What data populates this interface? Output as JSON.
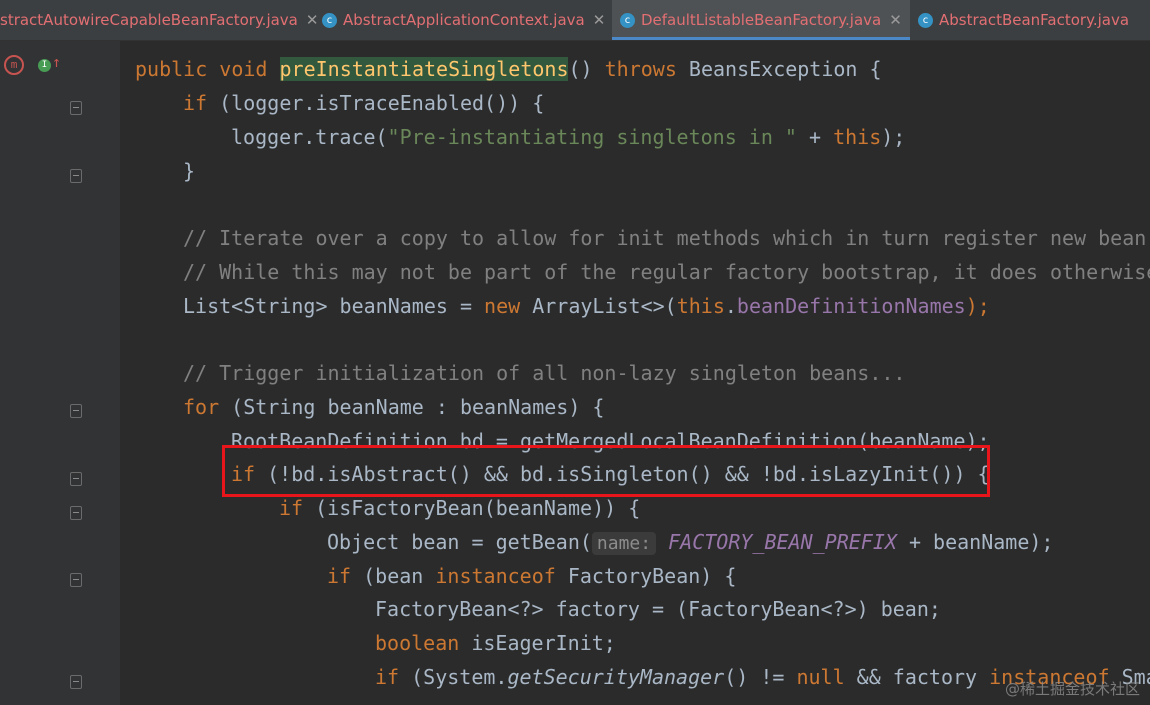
{
  "tabs": [
    {
      "label": "stractAutowireCapableBeanFactory.java"
    },
    {
      "label": "AbstractApplicationContext.java"
    },
    {
      "label": "DefaultListableBeanFactory.java"
    },
    {
      "label": "AbstractBeanFactory.java"
    }
  ],
  "code": {
    "l1": {
      "a": "public void ",
      "b": "preInstantiateSingletons",
      "c": "() ",
      "d": "throws",
      "e": " BeansException {"
    },
    "l2": {
      "a": "if",
      "b": " (logger.isTraceEnabled()) {"
    },
    "l3": {
      "a": "logger.trace(",
      "b": "\"Pre-instantiating singletons in \"",
      "c": " + ",
      "d": "this",
      "e": ");"
    },
    "l4": {
      "a": "}"
    },
    "l5": {
      "a": "// Iterate over a copy to allow for init methods which in turn register new bean"
    },
    "l6": {
      "a": "// While this may not be part of the regular factory bootstrap, it does otherwise"
    },
    "l7": {
      "a": "List<String> beanNames = ",
      "b": "new",
      "c": " ArrayList<>(",
      "d": "this",
      "e": ".",
      "f": "beanDefinitionNames",
      "g": ");"
    },
    "l8": {
      "a": "// Trigger initialization of all non-lazy singleton beans..."
    },
    "l9": {
      "a": "for",
      "b": " (String beanName : beanNames) {"
    },
    "l10": {
      "a": "RootBeanDefinition bd = getMergedLocalBeanDefinition(beanName);"
    },
    "l11": {
      "a": "if",
      "b": " (!bd.isAbstract() && bd.isSingleton() && !bd.isLazyInit()) {"
    },
    "l12": {
      "a": "if",
      "b": " (isFactoryBean(beanName)) {"
    },
    "l13": {
      "a": "Object bean = getBean(",
      "hint": "name:",
      "c": "FACTORY_BEAN_PREFIX",
      "d": " + beanName);"
    },
    "l14": {
      "a": "if",
      "b": " (bean ",
      "c": "instanceof",
      "d": " FactoryBean) {"
    },
    "l15": {
      "a": "FactoryBean<?> factory = (FactoryBean<?>) bean;"
    },
    "l16": {
      "a": "boolean",
      "b": " isEagerInit;"
    },
    "l17": {
      "a": "if",
      "b": " (System.",
      "c": "getSecurityManager",
      "d": "() != ",
      "e": "null",
      "f": " && factory ",
      "g": "instanceof",
      "h": " Sma"
    }
  },
  "watermark": "@稀土掘金技术社区"
}
